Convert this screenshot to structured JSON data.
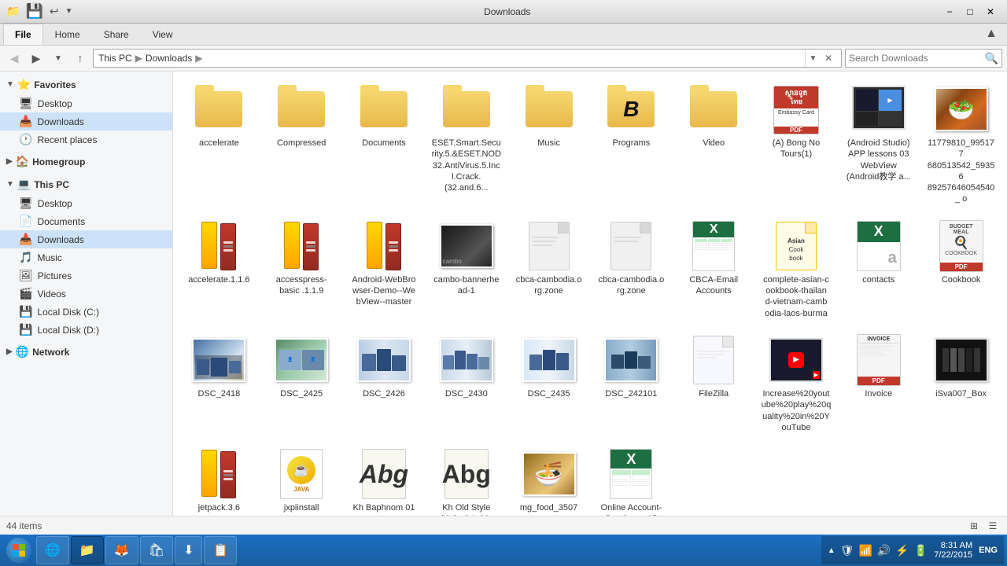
{
  "window": {
    "title": "Downloads",
    "controls": {
      "minimize": "−",
      "maximize": "□",
      "close": "✕"
    }
  },
  "ribbon": {
    "tabs": [
      "File",
      "Home",
      "Share",
      "View"
    ]
  },
  "nav": {
    "back_title": "Back",
    "forward_title": "Forward",
    "up_title": "Up",
    "address": [
      "This PC",
      "Downloads"
    ],
    "search_placeholder": "Search Downloads"
  },
  "sidebar": {
    "sections": [
      {
        "id": "favorites",
        "label": "Favorites",
        "icon": "⭐",
        "items": [
          {
            "id": "desktop",
            "label": "Desktop",
            "icon": "🖥"
          },
          {
            "id": "downloads",
            "label": "Downloads",
            "icon": "📥",
            "active": true
          },
          {
            "id": "recent",
            "label": "Recent places",
            "icon": "🕐"
          }
        ]
      },
      {
        "id": "homegroup",
        "label": "Homegroup",
        "icon": "🏠",
        "items": []
      },
      {
        "id": "this-pc",
        "label": "This PC",
        "icon": "💻",
        "items": [
          {
            "id": "desktop2",
            "label": "Desktop",
            "icon": "🖥"
          },
          {
            "id": "documents",
            "label": "Documents",
            "icon": "📄"
          },
          {
            "id": "downloads2",
            "label": "Downloads",
            "icon": "📥",
            "active": true
          },
          {
            "id": "music",
            "label": "Music",
            "icon": "🎵"
          },
          {
            "id": "pictures",
            "label": "Pictures",
            "icon": "🖼"
          },
          {
            "id": "videos",
            "label": "Videos",
            "icon": "🎬"
          },
          {
            "id": "local-c",
            "label": "Local Disk (C:)",
            "icon": "💾"
          },
          {
            "id": "local-d",
            "label": "Local Disk (D:)",
            "icon": "💾"
          }
        ]
      },
      {
        "id": "network",
        "label": "Network",
        "icon": "🌐",
        "items": []
      }
    ]
  },
  "files": [
    {
      "id": "f1",
      "name": "accelerate",
      "type": "folder",
      "icon_type": "folder"
    },
    {
      "id": "f2",
      "name": "Compressed",
      "type": "folder",
      "icon_type": "folder"
    },
    {
      "id": "f3",
      "name": "Documents",
      "type": "folder",
      "icon_type": "folder"
    },
    {
      "id": "f4",
      "name": "ESET.Smart.Secu rity.5.&ESET.NOD 32.AntiVirus.5.Inc l.Crack.(32.and.6...",
      "type": "folder",
      "icon_type": "folder"
    },
    {
      "id": "f5",
      "name": "Music",
      "type": "folder",
      "icon_type": "folder"
    },
    {
      "id": "f6",
      "name": "Programs",
      "type": "folder",
      "icon_type": "folder-b"
    },
    {
      "id": "f7",
      "name": "Video",
      "type": "folder",
      "icon_type": "folder"
    },
    {
      "id": "f8",
      "name": "(A) Bong No Tours(1)",
      "type": "file",
      "icon_type": "pdf-red"
    },
    {
      "id": "f9",
      "name": "(Android Studio) APP lessons 03 WebView (Android教学 a...",
      "type": "file",
      "icon_type": "screenshot"
    },
    {
      "id": "f10",
      "name": "11779810_995177 680513542_59356 89257646054540_ o",
      "type": "file",
      "icon_type": "photo-food"
    },
    {
      "id": "f11",
      "name": "accelerate.1.1.6",
      "type": "file",
      "icon_type": "winrar"
    },
    {
      "id": "f12",
      "name": "accesspress-basic .1.1.9",
      "type": "file",
      "icon_type": "winrar"
    },
    {
      "id": "f13",
      "name": "Android-WebBro wser-Demo--We bView--master",
      "type": "file",
      "icon_type": "winrar"
    },
    {
      "id": "f14",
      "name": "cambo-bannerhe ad-1",
      "type": "file",
      "icon_type": "photo-dark"
    },
    {
      "id": "f15",
      "name": "cbca-cambodia.o rg.zone",
      "type": "file",
      "icon_type": "doc-blank"
    },
    {
      "id": "f16",
      "name": "cbca-cambodia.o rg.zone",
      "type": "file",
      "icon_type": "doc-blank"
    },
    {
      "id": "f17",
      "name": "CBCA-Email Accounts",
      "type": "file",
      "icon_type": "excel"
    },
    {
      "id": "f18",
      "name": "complete-asian-c ookbook-thailan d-vietnam-camb odia-laos-burma",
      "type": "file",
      "icon_type": "doc-yellow"
    },
    {
      "id": "f19",
      "name": "contacts",
      "type": "file",
      "icon_type": "excel-a"
    },
    {
      "id": "f20",
      "name": "Cookbook",
      "type": "file",
      "icon_type": "pdf-cookbook"
    },
    {
      "id": "f21",
      "name": "DSC_2418",
      "type": "file",
      "icon_type": "photo-meeting"
    },
    {
      "id": "f22",
      "name": "DSC_2425",
      "type": "file",
      "icon_type": "photo-meeting"
    },
    {
      "id": "f23",
      "name": "DSC_2426",
      "type": "file",
      "icon_type": "photo-meeting"
    },
    {
      "id": "f24",
      "name": "DSC_2430",
      "type": "file",
      "icon_type": "photo-meeting"
    },
    {
      "id": "f25",
      "name": "DSC_2435",
      "type": "file",
      "icon_type": "photo-meeting"
    },
    {
      "id": "f26",
      "name": "DSC_242101",
      "type": "file",
      "icon_type": "photo-meeting"
    },
    {
      "id": "f27",
      "name": "FileZilla",
      "type": "file",
      "icon_type": "doc-blank"
    },
    {
      "id": "f28",
      "name": "Increase%20yout ube%20play%20q uality%20in%20Y ouTube",
      "type": "file",
      "icon_type": "video-thumb"
    },
    {
      "id": "f29",
      "name": "Invoice",
      "type": "file",
      "icon_type": "pdf-invoice"
    },
    {
      "id": "f30",
      "name": "iSva007_Box",
      "type": "file",
      "icon_type": "black-img"
    },
    {
      "id": "f31",
      "name": "jetpack.3.6",
      "type": "file",
      "icon_type": "winrar"
    },
    {
      "id": "f32",
      "name": "jxpiinstall",
      "type": "file",
      "icon_type": "java-icon"
    },
    {
      "id": "f33",
      "name": "Kh Baphnom 01",
      "type": "file",
      "icon_type": "font-abg"
    },
    {
      "id": "f34",
      "name": "Kh Old Style (Kakada's My Love) - Copy",
      "type": "file",
      "icon_type": "font-abg2"
    },
    {
      "id": "f35",
      "name": "mg_food_3507",
      "type": "file",
      "icon_type": "photo-food2"
    },
    {
      "id": "f36",
      "name": "Online Account-Database All",
      "type": "file",
      "icon_type": "excel-online"
    }
  ],
  "status": {
    "item_count": "44 items"
  },
  "taskbar": {
    "time": "8:31 AM",
    "date": "7/22/2015",
    "language": "ENG",
    "apps": [
      {
        "id": "start",
        "label": "Start"
      },
      {
        "id": "ie",
        "label": "Internet Explorer",
        "icon": "🌐"
      },
      {
        "id": "explorer",
        "label": "File Explorer",
        "icon": "📁",
        "active": true
      },
      {
        "id": "firefox",
        "label": "Firefox",
        "icon": "🦊"
      },
      {
        "id": "store",
        "label": "Store",
        "icon": "🛍"
      },
      {
        "id": "utorrent",
        "label": "uTorrent",
        "icon": "⬇"
      },
      {
        "id": "app6",
        "label": "App",
        "icon": "📋"
      }
    ]
  }
}
